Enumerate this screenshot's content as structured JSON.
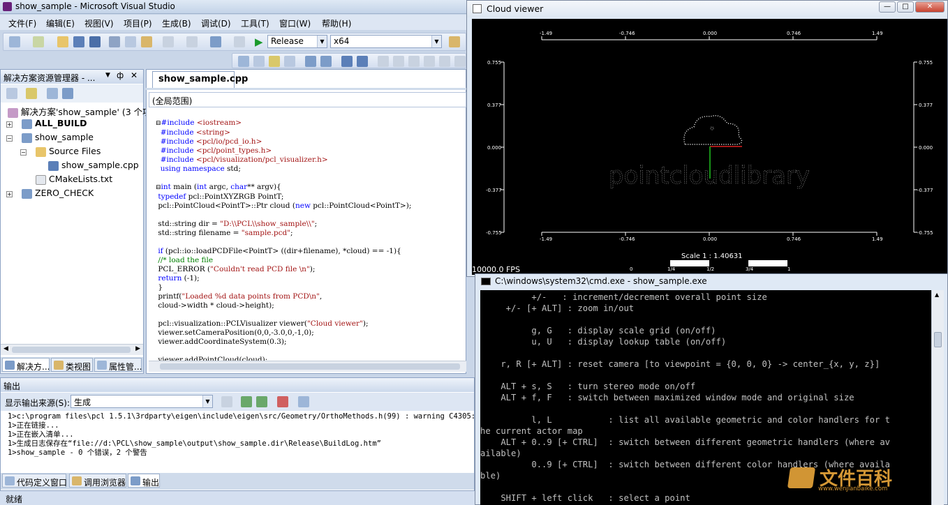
{
  "vs": {
    "title": "show_sample - Microsoft Visual Studio",
    "menu": [
      "文件(F)",
      "编辑(E)",
      "视图(V)",
      "项目(P)",
      "生成(B)",
      "调试(D)",
      "工具(T)",
      "窗口(W)",
      "帮助(H)"
    ],
    "config_combo": "Release",
    "platform_combo": "x64"
  },
  "solution_explorer": {
    "title": "解决方案资源管理器 - ...",
    "items": [
      {
        "label": "解决方案'show_sample' (3 个项"
      },
      {
        "label": "ALL_BUILD"
      },
      {
        "label": "show_sample"
      },
      {
        "label": "Source Files"
      },
      {
        "label": "show_sample.cpp"
      },
      {
        "label": "CMakeLists.txt"
      },
      {
        "label": "ZERO_CHECK"
      }
    ],
    "tabs": [
      "解决方...",
      "类视图",
      "属性管..."
    ]
  },
  "editor": {
    "tab": "show_sample.cpp",
    "scope": "(全局范围)"
  },
  "output": {
    "title": "输出",
    "source_label": "显示输出来源(S):",
    "source_value": "生成",
    "lines": [
      "1>c:\\program files\\pcl 1.5.1\\3rdparty\\eigen\\include\\eigen\\src/Geometry/OrthoMethods.h(99) : warning C4305: “sp",
      "1>正在链接...",
      "1>正在嵌入清单...",
      "1>生成日志保存在“file://d:\\PCL\\show_sample\\output\\show_sample.dir\\Release\\BuildLog.htm”",
      "1>show_sample - 0 个错误，2 个警告"
    ],
    "tabs": [
      "代码定义窗口",
      "调用浏览器",
      "输出"
    ]
  },
  "status": "就绪",
  "cloud_viewer": {
    "title": "Cloud viewer",
    "top_ticks": [
      "-1.49",
      "-0.746",
      "0.000",
      "0.746",
      "1.49"
    ],
    "bottom_ticks": [
      "-1.49",
      "-0.746",
      "0.000",
      "0.746",
      "1.49"
    ],
    "side_ticks": [
      "0.755",
      "0.377",
      "0.000",
      "-0.377",
      "-0.755"
    ],
    "scale_text": "Scale 1 : 1.40631",
    "scale_ticks": [
      "0",
      "1/4",
      "1/2",
      "3/4",
      "1"
    ],
    "fps": "10000.0 FPS",
    "cloud_label": "pointcloudlibrary"
  },
  "cmd": {
    "title": "C:\\windows\\system32\\cmd.exe - show_sample.exe",
    "lines": [
      "          +/-   : increment/decrement overall point size",
      "     +/- [+ ALT] : zoom in/out",
      "",
      "          g, G   : display scale grid (on/off)",
      "          u, U   : display lookup table (on/off)",
      "",
      "    r, R [+ ALT] : reset camera [to viewpoint = {0, 0, 0} -> center_{x, y, z}]",
      "",
      "    ALT + s, S   : turn stereo mode on/off",
      "    ALT + f, F   : switch between maximized window mode and original size",
      "",
      "          l, L           : list all available geometric and color handlers for t",
      "he current actor map",
      "    ALT + 0..9 [+ CTRL]  : switch between different geometric handlers (where av",
      "ailable)",
      "          0..9 [+ CTRL]  : switch between different color handlers (where availa",
      "ble)",
      "",
      "    SHIFT + left click   : select a point"
    ]
  },
  "watermark": {
    "text": "文件百科",
    "url": "www.wenjianbaike.com"
  }
}
